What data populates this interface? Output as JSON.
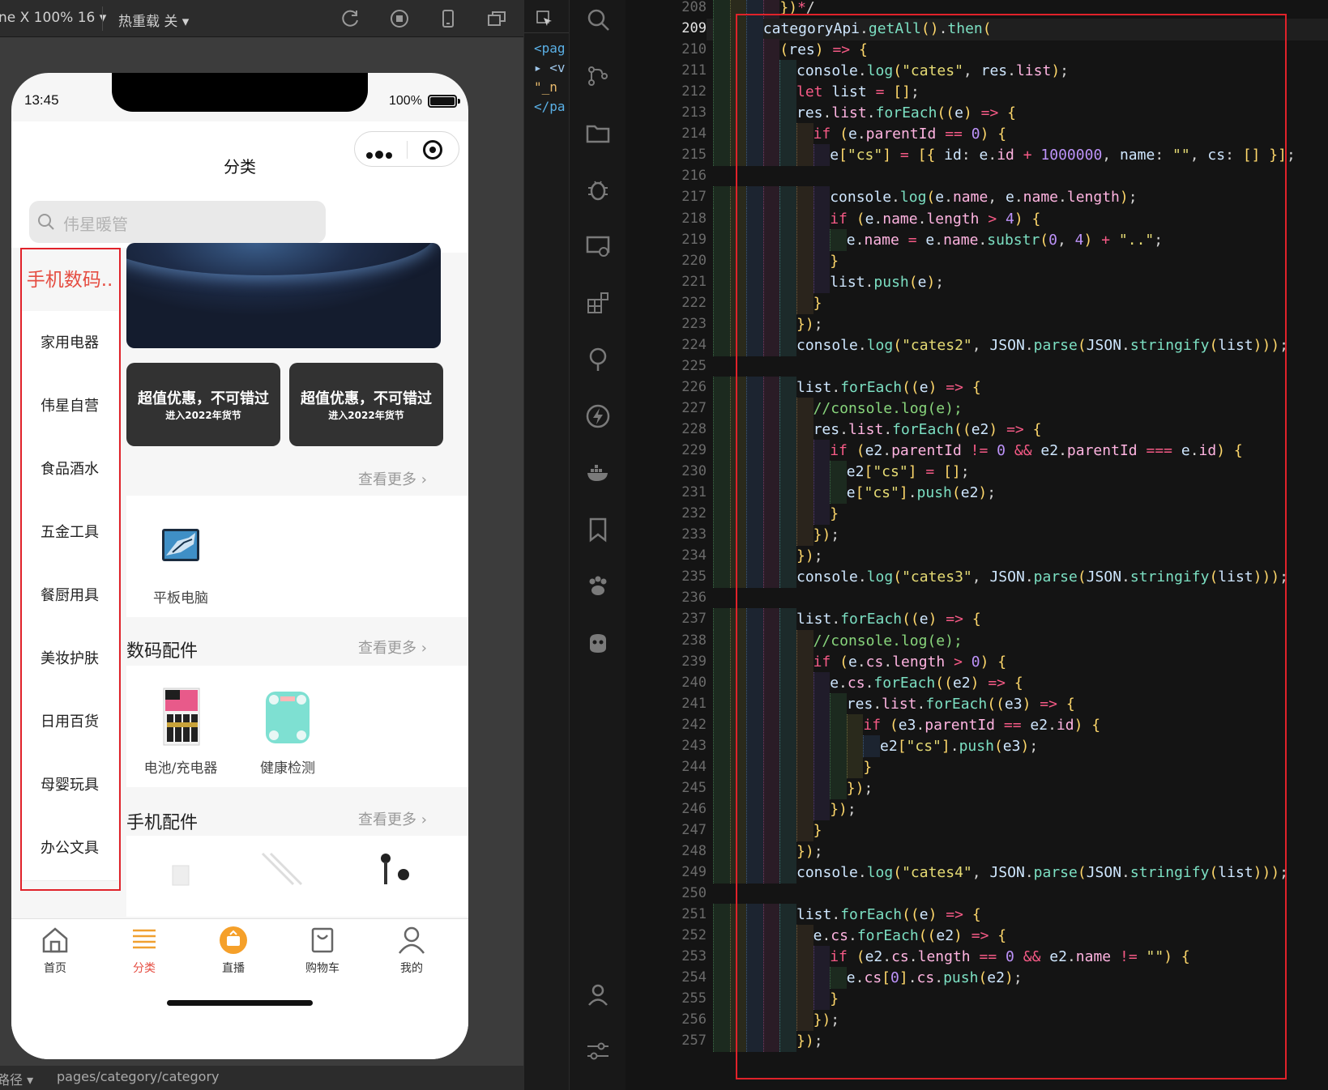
{
  "simulator": {
    "toolbar": {
      "device": "ne X 100% 16 ▾",
      "hot_reload": "热重载 关 ▾"
    },
    "status": {
      "time": "13:45",
      "battery": "100%"
    },
    "nav_title": "分类",
    "search_placeholder": "伟星暖管",
    "sidebar": {
      "items": [
        {
          "label": "手机数码..",
          "active": true
        },
        {
          "label": "家用电器"
        },
        {
          "label": "伟星自营"
        },
        {
          "label": "食品酒水"
        },
        {
          "label": "五金工具"
        },
        {
          "label": "餐厨用具"
        },
        {
          "label": "美妆护肤"
        },
        {
          "label": "日用百货"
        },
        {
          "label": "母婴玩具"
        },
        {
          "label": "办公文具"
        }
      ]
    },
    "promos": [
      {
        "title": "超值优惠，不可错过",
        "subtitle": "进入2022年货节"
      },
      {
        "title": "超值优惠，不可错过",
        "subtitle": "进入2022年货节"
      }
    ],
    "see_more": "查看更多 ›",
    "section1": {
      "product": "平板电脑"
    },
    "section2": {
      "title": "数码配件",
      "products": [
        "电池/充电器",
        "健康检测"
      ]
    },
    "section3": {
      "title": "手机配件"
    },
    "tabbar": {
      "tabs": [
        {
          "label": "首页"
        },
        {
          "label": "分类",
          "active": true
        },
        {
          "label": "直播"
        },
        {
          "label": "购物车"
        },
        {
          "label": "我的"
        }
      ]
    },
    "footer": {
      "left": "路径 ▾",
      "path": "pages/category/category"
    }
  },
  "explorer": {
    "lines": [
      "<pag",
      "▸ <v",
      "\"_n",
      "</pa"
    ]
  },
  "editor": {
    "current_line": 209,
    "first_line": 208,
    "lines": [
      "})*/",
      "categoryApi.getAll().then(",
      "(res) => {",
      "console.log(\"cates\", res.list);",
      "let list = [];",
      "res.list.forEach((e) => {",
      "if (e.parentId == 0) {",
      "e[\"cs\"] = [{ id: e.id + 1000000, name: \"\", cs: [] }];",
      "",
      "console.log(e.name, e.name.length);",
      "if (e.name.length > 4) {",
      "e.name = e.name.substr(0, 4) + \"..\";",
      "}",
      "list.push(e);",
      "}",
      "});",
      "console.log(\"cates2\", JSON.parse(JSON.stringify(list)));",
      "",
      "list.forEach((e) => {",
      "//console.log(e);",
      "res.list.forEach((e2) => {",
      "if (e2.parentId != 0 && e2.parentId === e.id) {",
      "e2[\"cs\"] = [];",
      "e[\"cs\"].push(e2);",
      "}",
      "});",
      "});",
      "console.log(\"cates3\", JSON.parse(JSON.stringify(list)));",
      "",
      "list.forEach((e) => {",
      "//console.log(e);",
      "if (e.cs.length > 0) {",
      "e.cs.forEach((e2) => {",
      "res.list.forEach((e3) => {",
      "if (e3.parentId == e2.id) {",
      "e2[\"cs\"].push(e3);",
      "}",
      "});",
      "});",
      "}",
      "});",
      "console.log(\"cates4\", JSON.parse(JSON.stringify(list)));",
      "",
      "list.forEach((e) => {",
      "e.cs.forEach((e2) => {",
      "if (e2.cs.length == 0 && e2.name != \"\") {",
      "e.cs[0].cs.push(e2);",
      "}",
      "});",
      "});"
    ],
    "indents": [
      4,
      3,
      4,
      5,
      5,
      5,
      6,
      7,
      0,
      7,
      7,
      8,
      7,
      7,
      6,
      5,
      5,
      0,
      5,
      6,
      6,
      7,
      8,
      8,
      7,
      6,
      5,
      5,
      0,
      5,
      6,
      6,
      7,
      8,
      9,
      10,
      9,
      8,
      7,
      6,
      5,
      5,
      0,
      5,
      6,
      7,
      8,
      7,
      6,
      5
    ]
  },
  "colors": {
    "highlight_box": "#e0222a",
    "accent_red": "#e54d42",
    "tab_orange": "#f0a030"
  }
}
